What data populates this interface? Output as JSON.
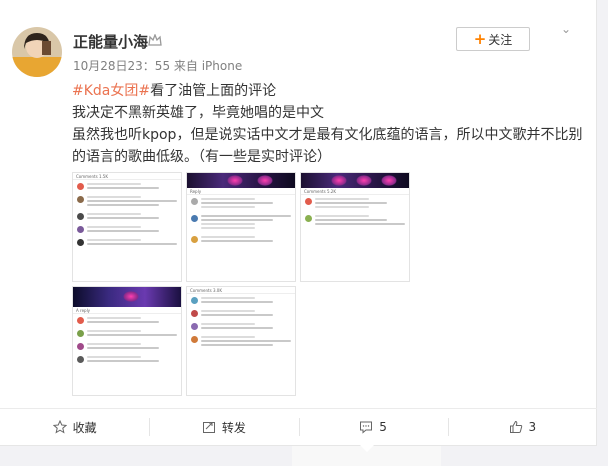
{
  "post": {
    "username": "正能量小海",
    "meta": "10月28日23：55 来自 iPhone",
    "follow_label": "关注",
    "line1_topic": "#Kda女团#",
    "line1_rest": "看了油管上面的评论",
    "line2": "我决定不黑新英雄了，毕竟她唱的是中文",
    "line3": "虽然我也听kpop，但是说实话中文才是最有文化底蕴的语言，所以中文歌并不比别的语言的歌曲低级。（有一些是实时评论）"
  },
  "thumbnails": [
    {
      "header": "Comments 1.5K"
    },
    {
      "header": "Reply"
    },
    {
      "header": "Comments 5.2K"
    },
    {
      "header": "A reply"
    },
    {
      "header": "Comments 3.0K"
    }
  ],
  "actions": {
    "favorite_label": "收藏",
    "repost_label": "转发",
    "comment_count": "5",
    "like_count": "3"
  },
  "colors": {
    "topic": "#eb7350",
    "follow_plus": "#ff8200"
  }
}
